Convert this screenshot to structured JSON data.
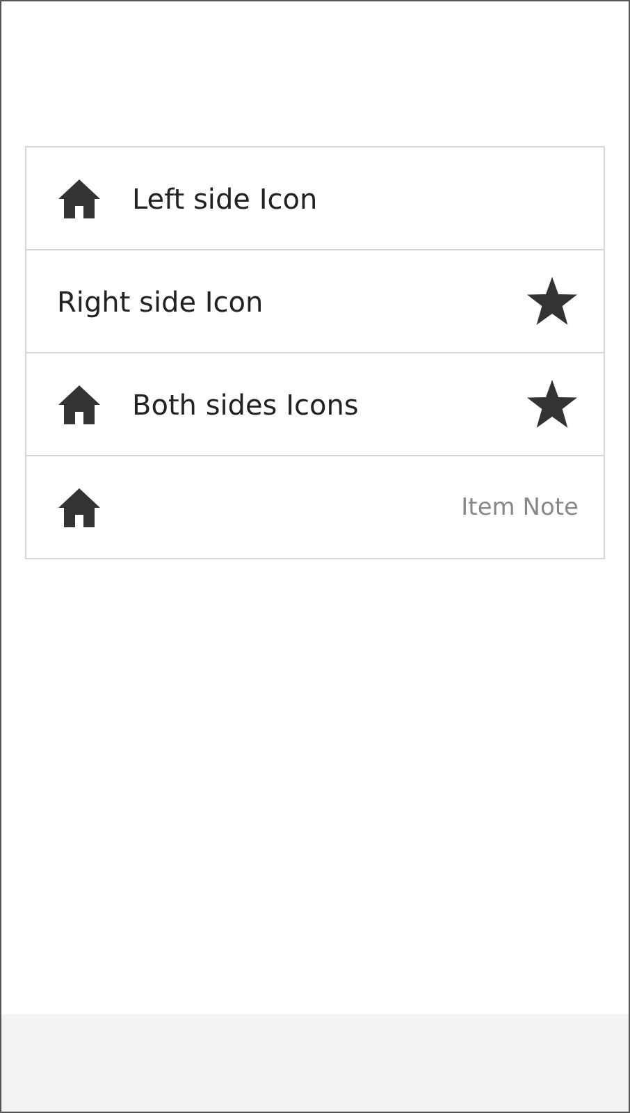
{
  "list": {
    "items": [
      {
        "kind": "left-icon",
        "label": "Left side Icon"
      },
      {
        "kind": "right-icon",
        "label": "Right side Icon"
      },
      {
        "kind": "both-icons",
        "label": "Both sides Icons"
      },
      {
        "kind": "icon-note",
        "note": "Item Note"
      }
    ]
  }
}
